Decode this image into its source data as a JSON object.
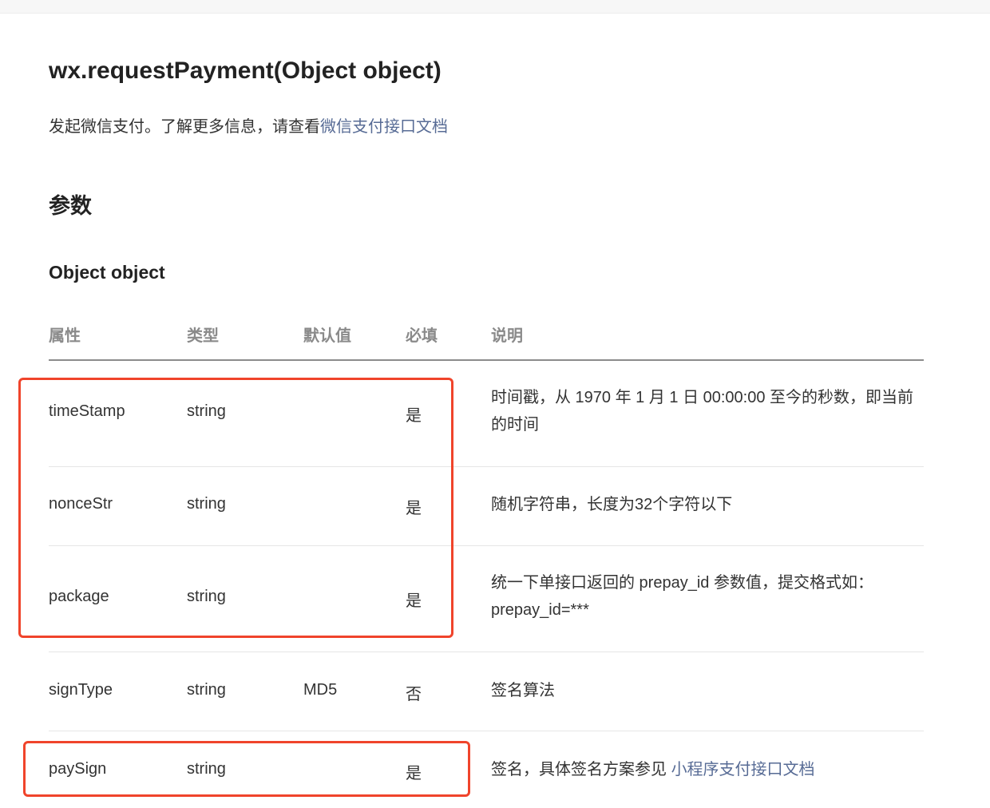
{
  "api": {
    "title": "wx.requestPayment(Object object)",
    "description": "发起微信支付。了解更多信息，请查看",
    "description_link": "微信支付接口文档"
  },
  "params": {
    "section_title": "参数",
    "object_title": "Object object",
    "headers": [
      "属性",
      "类型",
      "默认值",
      "必填",
      "说明"
    ],
    "rows": [
      {
        "name": "timeStamp",
        "type": "string",
        "default": "",
        "required": "是",
        "desc": "时间戳，从 1970 年 1 月 1 日 00:00:00 至今的秒数，即当前的时间",
        "desc_link": ""
      },
      {
        "name": "nonceStr",
        "type": "string",
        "default": "",
        "required": "是",
        "desc": "随机字符串，长度为32个字符以下",
        "desc_link": ""
      },
      {
        "name": "package",
        "type": "string",
        "default": "",
        "required": "是",
        "desc": "统一下单接口返回的 prepay_id 参数值，提交格式如：prepay_id=***",
        "desc_link": ""
      },
      {
        "name": "signType",
        "type": "string",
        "default": "MD5",
        "required": "否",
        "desc": "签名算法",
        "desc_link": ""
      },
      {
        "name": "paySign",
        "type": "string",
        "default": "",
        "required": "是",
        "desc": "签名，具体签名方案参见 ",
        "desc_link": "小程序支付接口文档"
      }
    ]
  },
  "colors": {
    "link": "#576b95",
    "highlight": "#f0442b"
  }
}
